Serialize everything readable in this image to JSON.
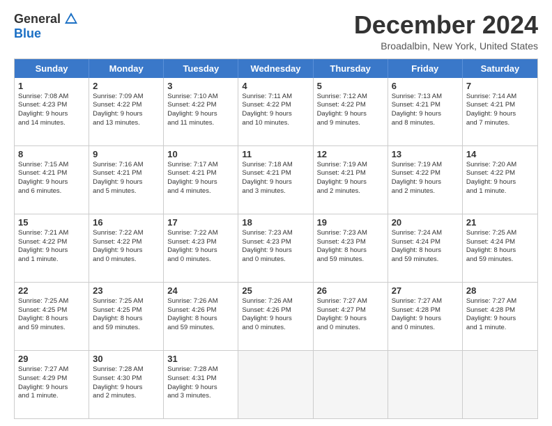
{
  "header": {
    "logo_general": "General",
    "logo_blue": "Blue",
    "title": "December 2024",
    "location": "Broadalbin, New York, United States"
  },
  "days": [
    "Sunday",
    "Monday",
    "Tuesday",
    "Wednesday",
    "Thursday",
    "Friday",
    "Saturday"
  ],
  "weeks": [
    [
      {
        "day": "1",
        "lines": [
          "Sunrise: 7:08 AM",
          "Sunset: 4:23 PM",
          "Daylight: 9 hours",
          "and 14 minutes."
        ]
      },
      {
        "day": "2",
        "lines": [
          "Sunrise: 7:09 AM",
          "Sunset: 4:22 PM",
          "Daylight: 9 hours",
          "and 13 minutes."
        ]
      },
      {
        "day": "3",
        "lines": [
          "Sunrise: 7:10 AM",
          "Sunset: 4:22 PM",
          "Daylight: 9 hours",
          "and 11 minutes."
        ]
      },
      {
        "day": "4",
        "lines": [
          "Sunrise: 7:11 AM",
          "Sunset: 4:22 PM",
          "Daylight: 9 hours",
          "and 10 minutes."
        ]
      },
      {
        "day": "5",
        "lines": [
          "Sunrise: 7:12 AM",
          "Sunset: 4:22 PM",
          "Daylight: 9 hours",
          "and 9 minutes."
        ]
      },
      {
        "day": "6",
        "lines": [
          "Sunrise: 7:13 AM",
          "Sunset: 4:21 PM",
          "Daylight: 9 hours",
          "and 8 minutes."
        ]
      },
      {
        "day": "7",
        "lines": [
          "Sunrise: 7:14 AM",
          "Sunset: 4:21 PM",
          "Daylight: 9 hours",
          "and 7 minutes."
        ]
      }
    ],
    [
      {
        "day": "8",
        "lines": [
          "Sunrise: 7:15 AM",
          "Sunset: 4:21 PM",
          "Daylight: 9 hours",
          "and 6 minutes."
        ]
      },
      {
        "day": "9",
        "lines": [
          "Sunrise: 7:16 AM",
          "Sunset: 4:21 PM",
          "Daylight: 9 hours",
          "and 5 minutes."
        ]
      },
      {
        "day": "10",
        "lines": [
          "Sunrise: 7:17 AM",
          "Sunset: 4:21 PM",
          "Daylight: 9 hours",
          "and 4 minutes."
        ]
      },
      {
        "day": "11",
        "lines": [
          "Sunrise: 7:18 AM",
          "Sunset: 4:21 PM",
          "Daylight: 9 hours",
          "and 3 minutes."
        ]
      },
      {
        "day": "12",
        "lines": [
          "Sunrise: 7:19 AM",
          "Sunset: 4:21 PM",
          "Daylight: 9 hours",
          "and 2 minutes."
        ]
      },
      {
        "day": "13",
        "lines": [
          "Sunrise: 7:19 AM",
          "Sunset: 4:22 PM",
          "Daylight: 9 hours",
          "and 2 minutes."
        ]
      },
      {
        "day": "14",
        "lines": [
          "Sunrise: 7:20 AM",
          "Sunset: 4:22 PM",
          "Daylight: 9 hours",
          "and 1 minute."
        ]
      }
    ],
    [
      {
        "day": "15",
        "lines": [
          "Sunrise: 7:21 AM",
          "Sunset: 4:22 PM",
          "Daylight: 9 hours",
          "and 1 minute."
        ]
      },
      {
        "day": "16",
        "lines": [
          "Sunrise: 7:22 AM",
          "Sunset: 4:22 PM",
          "Daylight: 9 hours",
          "and 0 minutes."
        ]
      },
      {
        "day": "17",
        "lines": [
          "Sunrise: 7:22 AM",
          "Sunset: 4:23 PM",
          "Daylight: 9 hours",
          "and 0 minutes."
        ]
      },
      {
        "day": "18",
        "lines": [
          "Sunrise: 7:23 AM",
          "Sunset: 4:23 PM",
          "Daylight: 9 hours",
          "and 0 minutes."
        ]
      },
      {
        "day": "19",
        "lines": [
          "Sunrise: 7:23 AM",
          "Sunset: 4:23 PM",
          "Daylight: 8 hours",
          "and 59 minutes."
        ]
      },
      {
        "day": "20",
        "lines": [
          "Sunrise: 7:24 AM",
          "Sunset: 4:24 PM",
          "Daylight: 8 hours",
          "and 59 minutes."
        ]
      },
      {
        "day": "21",
        "lines": [
          "Sunrise: 7:25 AM",
          "Sunset: 4:24 PM",
          "Daylight: 8 hours",
          "and 59 minutes."
        ]
      }
    ],
    [
      {
        "day": "22",
        "lines": [
          "Sunrise: 7:25 AM",
          "Sunset: 4:25 PM",
          "Daylight: 8 hours",
          "and 59 minutes."
        ]
      },
      {
        "day": "23",
        "lines": [
          "Sunrise: 7:25 AM",
          "Sunset: 4:25 PM",
          "Daylight: 8 hours",
          "and 59 minutes."
        ]
      },
      {
        "day": "24",
        "lines": [
          "Sunrise: 7:26 AM",
          "Sunset: 4:26 PM",
          "Daylight: 8 hours",
          "and 59 minutes."
        ]
      },
      {
        "day": "25",
        "lines": [
          "Sunrise: 7:26 AM",
          "Sunset: 4:26 PM",
          "Daylight: 9 hours",
          "and 0 minutes."
        ]
      },
      {
        "day": "26",
        "lines": [
          "Sunrise: 7:27 AM",
          "Sunset: 4:27 PM",
          "Daylight: 9 hours",
          "and 0 minutes."
        ]
      },
      {
        "day": "27",
        "lines": [
          "Sunrise: 7:27 AM",
          "Sunset: 4:28 PM",
          "Daylight: 9 hours",
          "and 0 minutes."
        ]
      },
      {
        "day": "28",
        "lines": [
          "Sunrise: 7:27 AM",
          "Sunset: 4:28 PM",
          "Daylight: 9 hours",
          "and 1 minute."
        ]
      }
    ],
    [
      {
        "day": "29",
        "lines": [
          "Sunrise: 7:27 AM",
          "Sunset: 4:29 PM",
          "Daylight: 9 hours",
          "and 1 minute."
        ]
      },
      {
        "day": "30",
        "lines": [
          "Sunrise: 7:28 AM",
          "Sunset: 4:30 PM",
          "Daylight: 9 hours",
          "and 2 minutes."
        ]
      },
      {
        "day": "31",
        "lines": [
          "Sunrise: 7:28 AM",
          "Sunset: 4:31 PM",
          "Daylight: 9 hours",
          "and 3 minutes."
        ]
      },
      {
        "day": "",
        "lines": []
      },
      {
        "day": "",
        "lines": []
      },
      {
        "day": "",
        "lines": []
      },
      {
        "day": "",
        "lines": []
      }
    ]
  ]
}
